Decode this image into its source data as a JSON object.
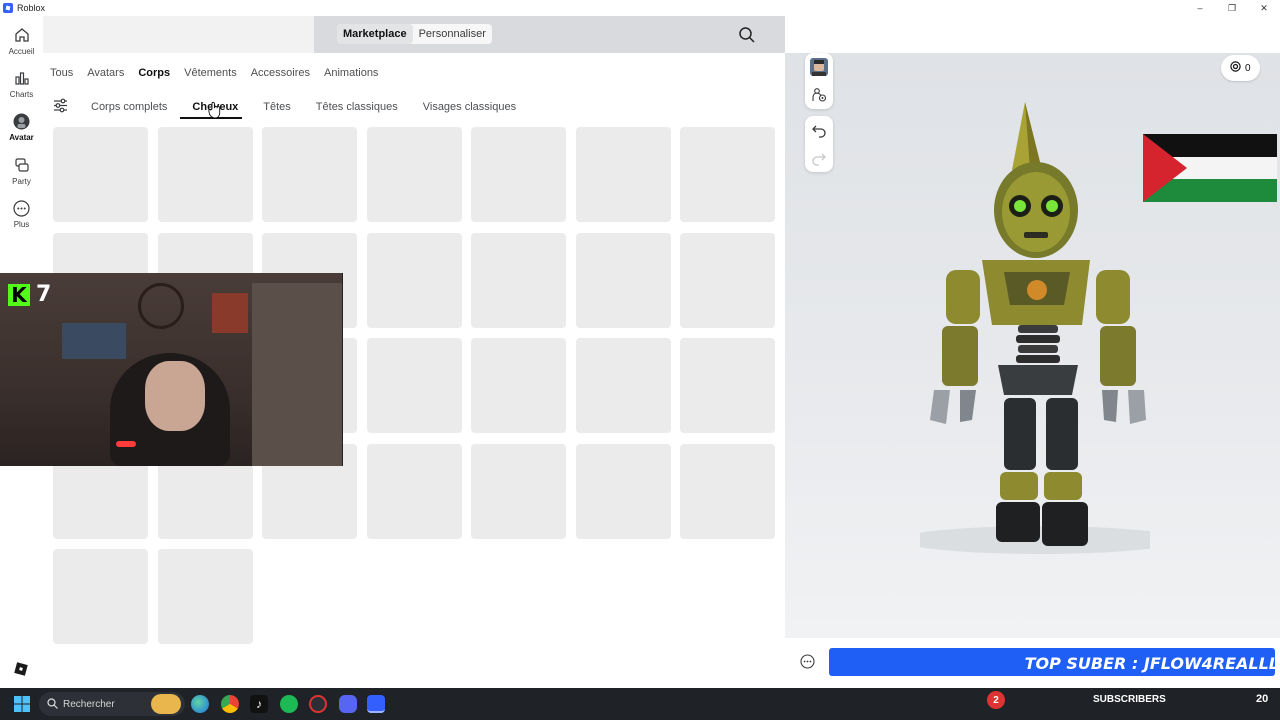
{
  "window": {
    "title": "Roblox"
  },
  "rail": {
    "items": [
      {
        "label": "Accueil",
        "icon": "home-icon"
      },
      {
        "label": "Charts",
        "icon": "charts-icon"
      },
      {
        "label": "Avatar",
        "icon": "avatar-icon",
        "active": true
      },
      {
        "label": "Party",
        "icon": "party-icon"
      },
      {
        "label": "Plus",
        "icon": "more-icon"
      }
    ]
  },
  "header": {
    "segments": [
      "Marketplace",
      "Personnaliser"
    ],
    "selected_segment": "Marketplace"
  },
  "categories": {
    "items": [
      "Tous",
      "Avatars",
      "Corps",
      "Vêtements",
      "Accessoires",
      "Animations"
    ],
    "selected": "Corps"
  },
  "subcategories": {
    "items": [
      "Corps complets",
      "Cheveux",
      "Têtes",
      "Têtes classiques",
      "Visages classiques"
    ],
    "selected": "Cheveux"
  },
  "grid": {
    "placeholder_count": 30
  },
  "stream_overlay": {
    "kick_count": "7"
  },
  "preview": {
    "robux_balance": "0"
  },
  "ticker": {
    "text": "TOP SUBER : JFLOW4REALLL"
  },
  "taskbar": {
    "search_label": "Rechercher",
    "notification_count": "2",
    "subscribers_label": "SUBSCRIBERS",
    "overlay_number": "20"
  },
  "colors": {
    "accent": "#335fff",
    "ticker": "#1f5ff5",
    "tile": "#ebebeb",
    "kick": "#53fc18"
  }
}
